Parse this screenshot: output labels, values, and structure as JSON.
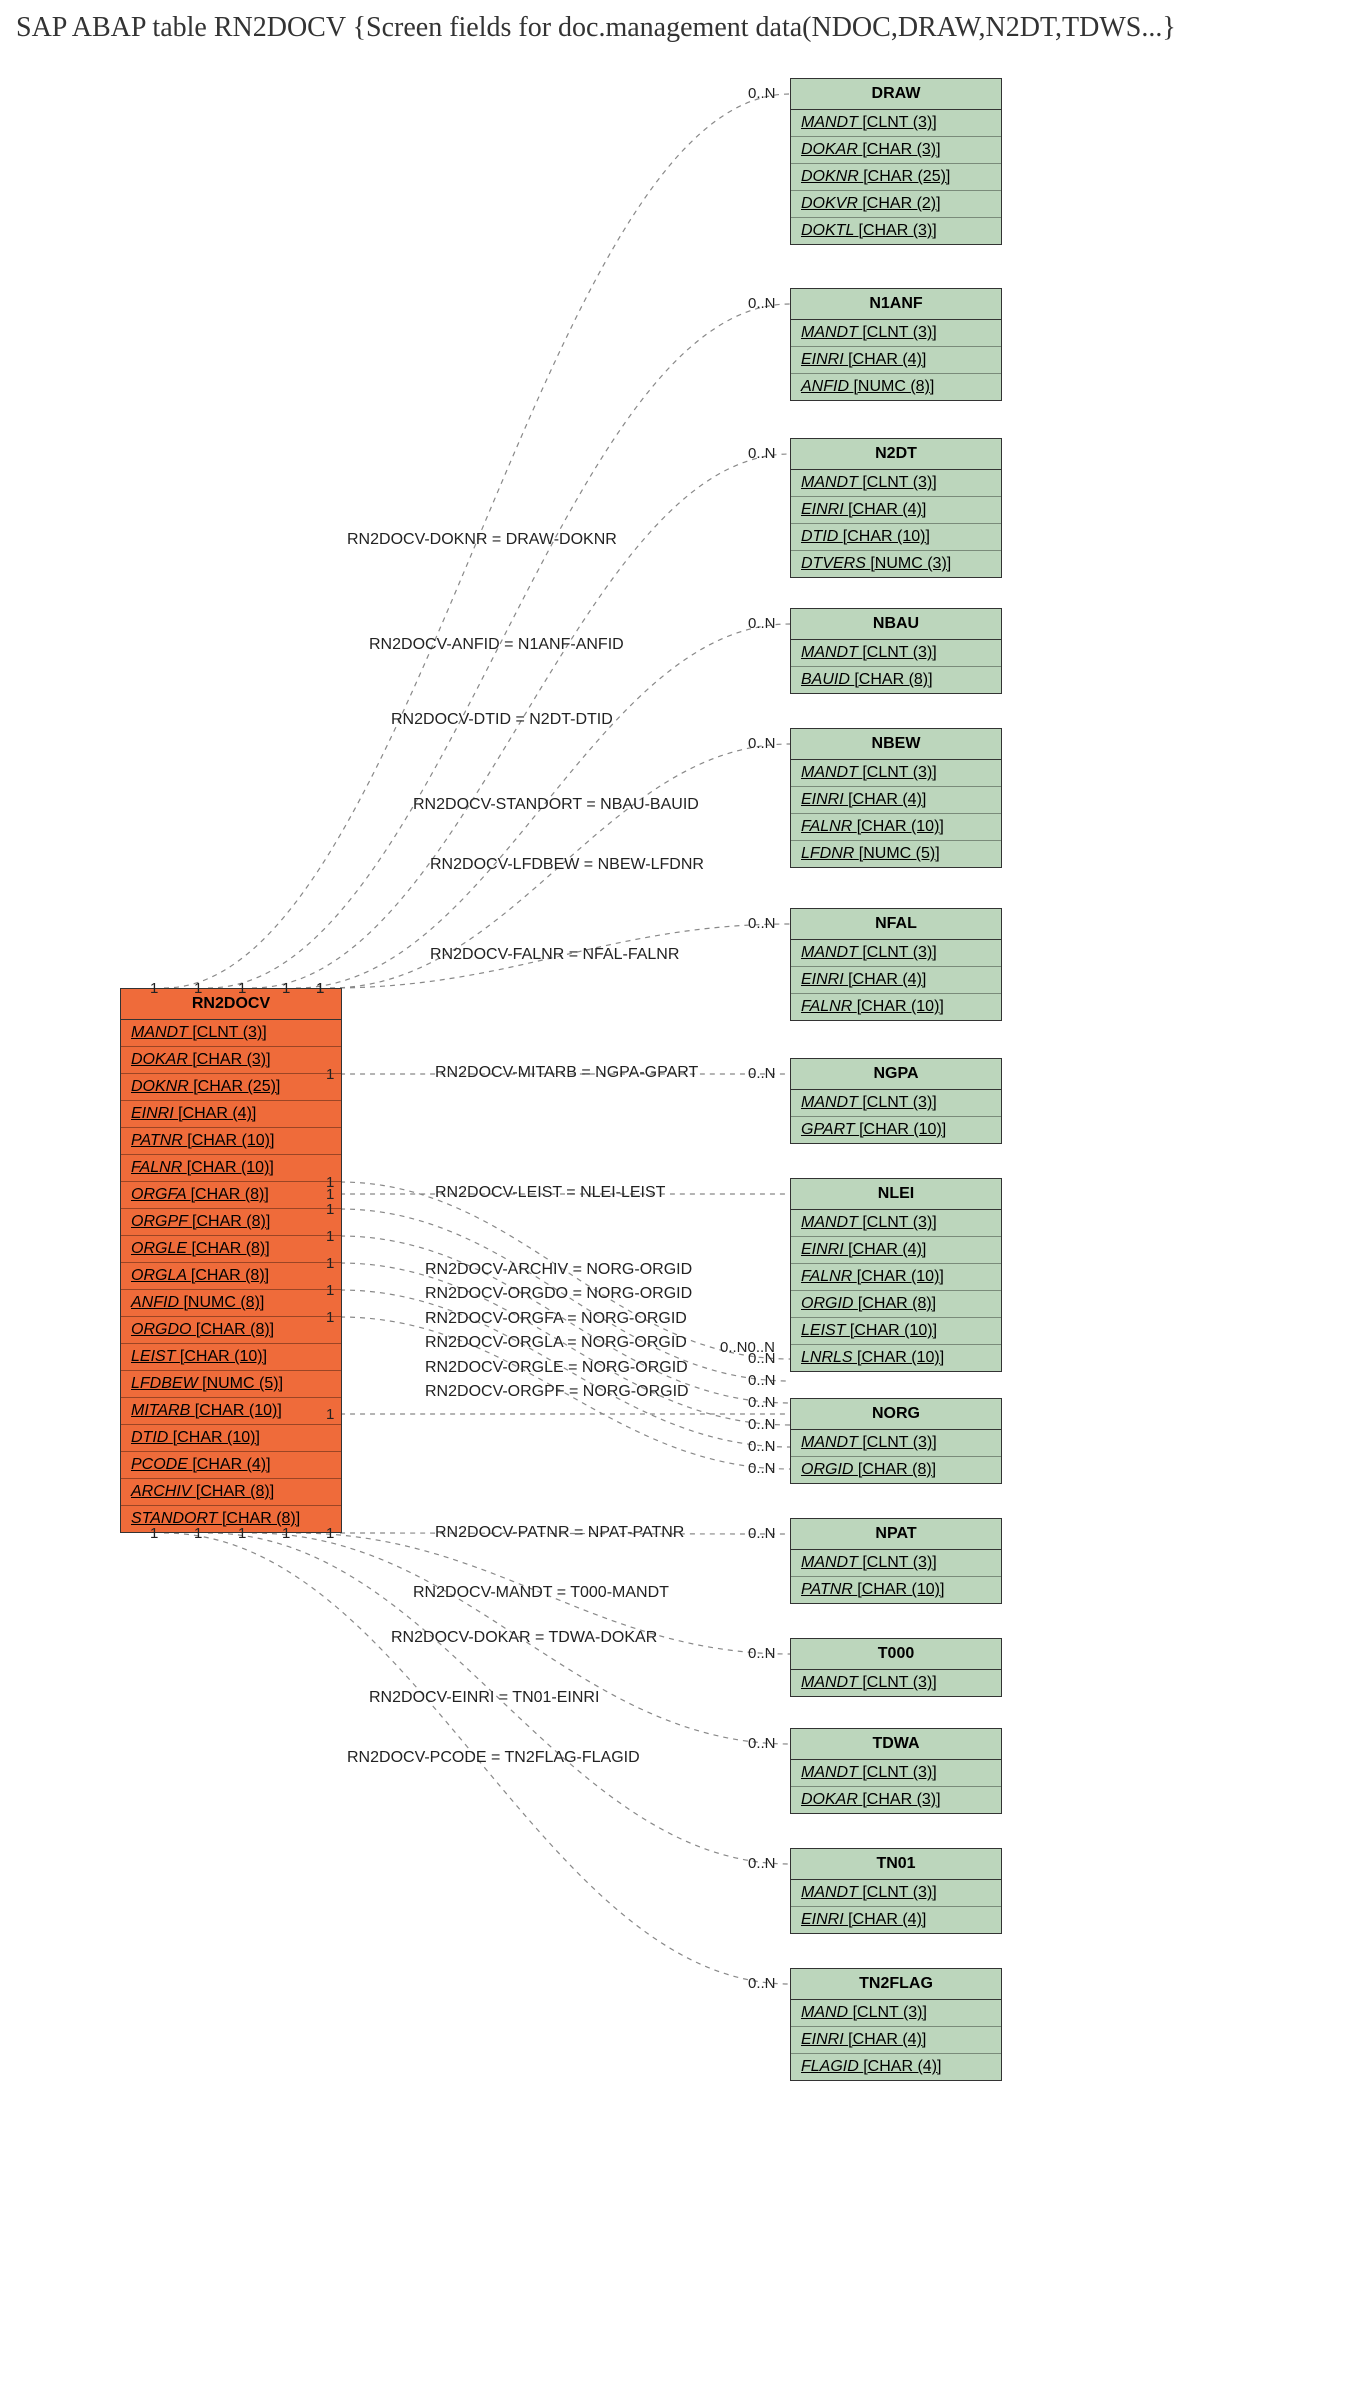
{
  "title": "SAP ABAP table RN2DOCV {Screen fields for doc.management data(NDOC,DRAW,N2DT,TDWS...}",
  "mainEntity": {
    "name": "RN2DOCV",
    "fields": [
      "MANDT [CLNT (3)]",
      "DOKAR [CHAR (3)]",
      "DOKNR [CHAR (25)]",
      "EINRI [CHAR (4)]",
      "PATNR [CHAR (10)]",
      "FALNR [CHAR (10)]",
      "ORGFA [CHAR (8)]",
      "ORGPF [CHAR (8)]",
      "ORGLE [CHAR (8)]",
      "ORGLA [CHAR (8)]",
      "ANFID [NUMC (8)]",
      "ORGDO [CHAR (8)]",
      "LEIST [CHAR (10)]",
      "LFDBEW [NUMC (5)]",
      "MITARB [CHAR (10)]",
      "DTID [CHAR (10)]",
      "PCODE [CHAR (4)]",
      "ARCHIV [CHAR (8)]",
      "STANDORT [CHAR (8)]"
    ]
  },
  "targets": [
    {
      "name": "DRAW",
      "fields": [
        "MANDT [CLNT (3)]",
        "DOKAR [CHAR (3)]",
        "DOKNR [CHAR (25)]",
        "DOKVR [CHAR (2)]",
        "DOKTL [CHAR (3)]"
      ],
      "edge": "RN2DOCV-DOKNR = DRAW-DOKNR",
      "card": "0..N"
    },
    {
      "name": "N1ANF",
      "fields": [
        "MANDT [CLNT (3)]",
        "EINRI [CHAR (4)]",
        "ANFID [NUMC (8)]"
      ],
      "edge": "RN2DOCV-ANFID = N1ANF-ANFID",
      "card": "0..N"
    },
    {
      "name": "N2DT",
      "fields": [
        "MANDT [CLNT (3)]",
        "EINRI [CHAR (4)]",
        "DTID [CHAR (10)]",
        "DTVERS [NUMC (3)]"
      ],
      "edge": "RN2DOCV-DTID = N2DT-DTID",
      "card": "0..N"
    },
    {
      "name": "NBAU",
      "fields": [
        "MANDT [CLNT (3)]",
        "BAUID [CHAR (8)]"
      ],
      "edge": "RN2DOCV-STANDORT = NBAU-BAUID",
      "card": "0..N"
    },
    {
      "name": "NBEW",
      "fields": [
        "MANDT [CLNT (3)]",
        "EINRI [CHAR (4)]",
        "FALNR [CHAR (10)]",
        "LFDNR [NUMC (5)]"
      ],
      "edge": "RN2DOCV-LFDBEW = NBEW-LFDNR",
      "card": "0..N"
    },
    {
      "name": "NFAL",
      "fields": [
        "MANDT [CLNT (3)]",
        "EINRI [CHAR (4)]",
        "FALNR [CHAR (10)]"
      ],
      "edge": "RN2DOCV-FALNR = NFAL-FALNR",
      "card": "0..N"
    },
    {
      "name": "NGPA",
      "fields": [
        "MANDT [CLNT (3)]",
        "GPART [CHAR (10)]"
      ],
      "edge": "RN2DOCV-MITARB = NGPA-GPART",
      "card": "0..N"
    },
    {
      "name": "NLEI",
      "fields": [
        "MANDT [CLNT (3)]",
        "EINRI [CHAR (4)]",
        "FALNR [CHAR (10)]",
        "ORGID [CHAR (8)]",
        "LEIST [CHAR (10)]",
        "LNRLS [CHAR (10)]"
      ],
      "edge": "RN2DOCV-LEIST = NLEI-LEIST",
      "card": ""
    },
    {
      "name": "NORG",
      "fields": [
        "MANDT [CLNT (3)]",
        "ORGID [CHAR (8)]"
      ],
      "edge": "",
      "card": ""
    },
    {
      "name": "NPAT",
      "fields": [
        "MANDT [CLNT (3)]",
        "PATNR [CHAR (10)]"
      ],
      "edge": "RN2DOCV-PATNR = NPAT-PATNR",
      "card": "0..N"
    },
    {
      "name": "T000",
      "fields": [
        "MANDT [CLNT (3)]"
      ],
      "edge": "RN2DOCV-MANDT = T000-MANDT",
      "card": "0..N"
    },
    {
      "name": "TDWA",
      "fields": [
        "MANDT [CLNT (3)]",
        "DOKAR [CHAR (3)]"
      ],
      "edge": "RN2DOCV-DOKAR = TDWA-DOKAR",
      "card": "0..N"
    },
    {
      "name": "TN01",
      "fields": [
        "MANDT [CLNT (3)]",
        "EINRI [CHAR (4)]"
      ],
      "edge": "RN2DOCV-EINRI = TN01-EINRI",
      "card": "0..N"
    },
    {
      "name": "TN2FLAG",
      "fields": [
        "MAND [CLNT (3)]",
        "EINRI [CHAR (4)]",
        "FLAGID [CHAR (4)]"
      ],
      "edge": "RN2DOCV-PCODE = TN2FLAG-FLAGID",
      "card": "0..N"
    }
  ],
  "norgEdges": [
    {
      "label": "RN2DOCV-ARCHIV = NORG-ORGID",
      "card": "0..N"
    },
    {
      "label": "RN2DOCV-ORGDO = NORG-ORGID",
      "card": "0..N"
    },
    {
      "label": "RN2DOCV-ORGFA = NORG-ORGID",
      "card": "0..N"
    },
    {
      "label": "RN2DOCV-ORGLA = NORG-ORGID",
      "card": "0..N"
    },
    {
      "label": "RN2DOCV-ORGLE = NORG-ORGID",
      "card": "0..N"
    },
    {
      "label": "RN2DOCV-ORGPF = NORG-ORGID",
      "card": "0..N"
    }
  ],
  "mainCardinalities": [
    "1",
    "1",
    "1",
    "1",
    "1",
    "1",
    "1",
    "1",
    "1",
    "1",
    "1",
    "1",
    "1",
    "1",
    "1",
    "1",
    "1",
    "1",
    "1"
  ]
}
